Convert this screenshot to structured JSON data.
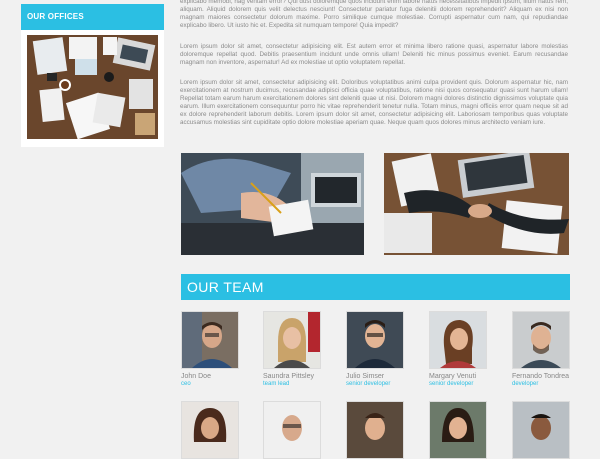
{
  "sidebar": {
    "title": "OUR OFFICES"
  },
  "content": {
    "paragraph_1": "explicabo memobi, hag ventam error? Qui dust doloremque quos incidunt enim labore natus necessitatibus impedit ipsum, illum natus rem, aliquam. Aliquid dolorem quis velit delectus nesciunt! Consectetur pariatur fuga delenitii dolorem reprehenderit? Aliquam ex nisi non magnam maiores consectetur dolorum maxime. Porro similique cumque molestiae. Corrupti aspernatur cum nam, qui repudiandae explicabo libero. Ut iusto hic et. Expedita sit numquam tempore! Quia impedit?",
    "paragraph_2": "Lorem ipsum dolor sit amet, consectetur adipisicing elit. Est autem error et minima libero ratione quasi, aspernatur labore molestias doloremque repellat quod. Debitis praesentium incidunt unde omnis ullam! Deleniti hic minus possimus eveniet. Earum recusandae magnam non inventore, aspernatur! Ad ex molestiae ut optio voluptatem repellat.",
    "paragraph_3": "Lorem ipsum dolor sit amet, consectetur adipisicing elit. Doloribus voluptatibus animi culpa provident quis. Dolorum aspernatur hic, nam exercitationem at nostrum ducimus, recusandae adipisci officia quae voluptatibus, ratione nisi quos consequatur quasi sunt harum ullam! Repellat totam earum harum exercitationem dolores sint deleniti quae ut nisi. Dolorem magni dolores distinctio dignissimos voluptate quia earum. Illum exercitationem consequuntur porro hic vitae reprehenderit tenetur nulla. Totam minus, magni officiis error quam neque sit ad ex dolore reprehenderit laborum debitis. Lorem ipsum dolor sit amet, consectetur adipisicing elit. Laboriosam temporibus quas voluptate accusamus molestias sint cupiditate optio dolore molestiae aperiam quae. Neque quam quos dolores minus architecto veniam iure."
  },
  "team": {
    "title": "OUR TEAM",
    "members": [
      {
        "name": "John Doe",
        "role": "ceo"
      },
      {
        "name": "Saundra Pittsley",
        "role": "team lead"
      },
      {
        "name": "Julio Simser",
        "role": "senior developer"
      },
      {
        "name": "Margary Venuti",
        "role": "senior developer"
      },
      {
        "name": "Fernando Tondrea",
        "role": "developer"
      }
    ]
  }
}
